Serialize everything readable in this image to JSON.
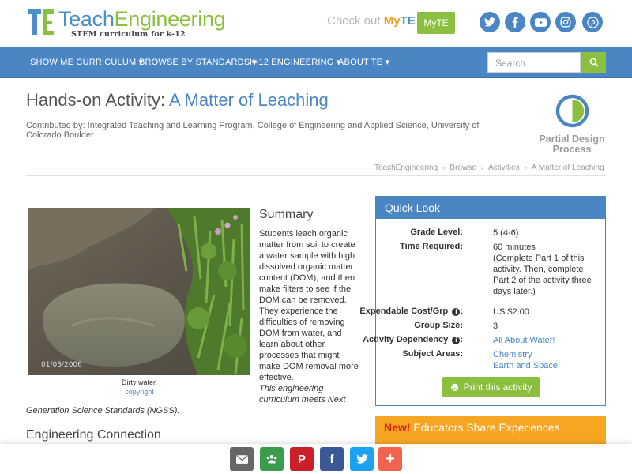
{
  "brand": {
    "word_teach": "Teach",
    "word_engineering": "Engineering",
    "tagline": "STEM curriculum for k-12",
    "colors": {
      "blue": "#4a86c4",
      "green": "#8bbf3f",
      "orange": "#f6a623"
    }
  },
  "header": {
    "checkout_prefix": "Check out ",
    "checkout_my": "My",
    "checkout_te": "TE",
    "myte_button": "MyTE",
    "social_icons": [
      "twitter-icon",
      "facebook-icon",
      "youtube-icon",
      "instagram-icon",
      "pinterest-icon"
    ]
  },
  "nav": {
    "items": [
      "SHOW ME CURRICULUM",
      "BROWSE BY STANDARDS",
      "K-12 ENGINEERING",
      "ABOUT TE"
    ],
    "search_placeholder": "Search"
  },
  "page": {
    "title_prefix": "Hands-on Activity: ",
    "title_name": "A Matter of Leaching",
    "contributed": "Contributed by: Integrated Teaching and Learning Program, College of Engineering and Applied Science, University of Colorado Boulder",
    "process_label": "Partial Design Process",
    "breadcrumb": [
      "TeachEngineering",
      "Browse",
      "Activities",
      "A Matter of Leaching"
    ]
  },
  "photo": {
    "date_stamp": "01/03/2006",
    "caption": "Dirty water.",
    "copyright": "copyright"
  },
  "summary": {
    "heading": "Summary",
    "body": "Students leach organic matter from soil to create a water sample with high dissolved organic matter content (DOM), and then make filters to see if the DOM can be removed. They experience the difficulties of removing DOM from water, and learn about other processes that might make DOM removal more effective.",
    "ngss_part1": "This engineering curriculum meets Next",
    "ngss_part2": "Generation Science Standards (NGSS)."
  },
  "engineering_connection": "Engineering Connection",
  "quick_look": {
    "heading": "Quick Look",
    "grade_label": "Grade Level:",
    "grade_value": "5 (4-6)",
    "time_label": "Time Required:",
    "time_value": "60 minutes",
    "time_note": "(Complete Part 1 of this activity. Then, complete Part 2 of the activity three days later.)",
    "cost_label": "Expendable Cost/Grp",
    "cost_value": "US $2.00",
    "group_label": "Group Size:",
    "group_value": "3",
    "dependency_label": "Activity Dependency",
    "dependency_value": "All About Water!",
    "subject_label": "Subject Areas:",
    "subjects": [
      "Chemistry",
      "Earth and Space"
    ],
    "print_label": "Print this activity"
  },
  "educators": {
    "new_label": "New!",
    "text": " Educators Share Experiences"
  },
  "share_icons": [
    "email-icon",
    "google-classroom-icon",
    "pinterest-icon",
    "facebook-icon",
    "twitter-icon",
    "more-icon"
  ]
}
